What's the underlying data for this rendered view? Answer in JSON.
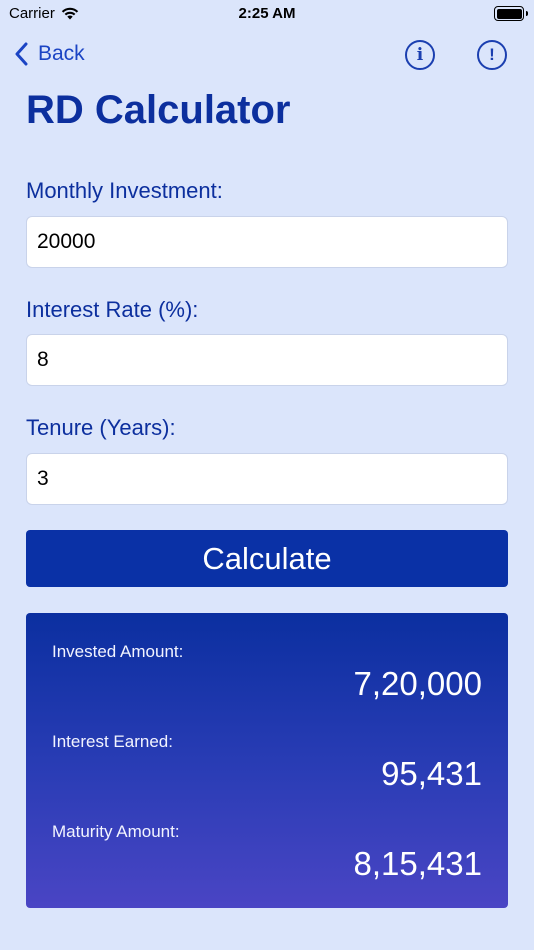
{
  "status_bar": {
    "carrier": "Carrier",
    "time": "2:25 AM"
  },
  "nav": {
    "back_label": "Back",
    "info_icon": "info-icon",
    "alert_icon": "alert-icon"
  },
  "title": "RD Calculator",
  "form": {
    "monthly_investment": {
      "label": "Monthly Investment:",
      "value": "20000"
    },
    "interest_rate": {
      "label": "Interest Rate (%):",
      "value": "8"
    },
    "tenure": {
      "label": "Tenure (Years):",
      "value": "3"
    },
    "calculate_label": "Calculate"
  },
  "results": {
    "invested": {
      "label": "Invested Amount:",
      "value": "7,20,000"
    },
    "interest": {
      "label": "Interest Earned:",
      "value": "95,431"
    },
    "maturity": {
      "label": "Maturity Amount:",
      "value": "8,15,431"
    }
  },
  "colors": {
    "background": "#dbe5fb",
    "accent": "#0a31a6",
    "link": "#1b44c4"
  }
}
